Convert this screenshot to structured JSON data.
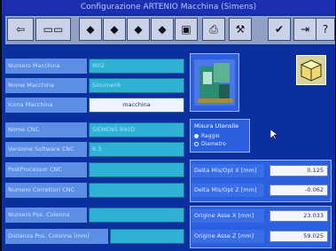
{
  "window": {
    "title": "Configurazione ARTENIO Macchina (Simens)"
  },
  "toolbar": {
    "buttons": [
      {
        "name": "back-icon"
      },
      {
        "name": "toggle-icon"
      },
      {
        "name": "diamond-1-icon"
      },
      {
        "name": "diamond-2-icon"
      },
      {
        "name": "diamond-3-icon"
      },
      {
        "name": "diamond-4-icon"
      },
      {
        "name": "save-icon"
      },
      {
        "name": "print-icon"
      },
      {
        "name": "tool-icon"
      },
      {
        "name": "check-icon"
      },
      {
        "name": "exit-icon"
      },
      {
        "name": "help-icon"
      }
    ]
  },
  "form": {
    "numero_macchina": {
      "label": "Numero Macchina",
      "value": "M02"
    },
    "nome_macchina": {
      "label": "Nome Macchina",
      "value": "Sinumerik"
    },
    "icona_macchina": {
      "label": "Icona Macchina",
      "value": "macchina"
    },
    "nome_cnc": {
      "label": "Nome CNC",
      "value": "SIEMENS 840D"
    },
    "versione_software_cnc": {
      "label": "Versione Software CNC",
      "value": "6.3"
    },
    "postprocessor_cnc": {
      "label": "PostProcessor CNC",
      "value": ""
    },
    "numero_correttori_cnc": {
      "label": "Numero Correttori CNC",
      "value": ""
    },
    "numero_pos_colonna": {
      "label": "Numero Pos. Colonna",
      "value": ""
    },
    "distanza_pos_colonna": {
      "label": "Distanza Pos. Colonna (mm)",
      "value": ""
    }
  },
  "misura_utensile": {
    "title": "Misura Utensile",
    "options": [
      {
        "label": "Raggio",
        "selected": true
      },
      {
        "label": "Diametro",
        "selected": false
      }
    ]
  },
  "values": [
    {
      "label": "Delta Mis/Opt X [mm]",
      "value": "0.125"
    },
    {
      "label": "Delta Mis/Opt Z [mm]",
      "value": "-0.062"
    },
    {
      "label": "Origine Asse X [mm]",
      "value": "23.033"
    },
    {
      "label": "Origine Asse Z [mm]",
      "value": "59.025"
    }
  ]
}
